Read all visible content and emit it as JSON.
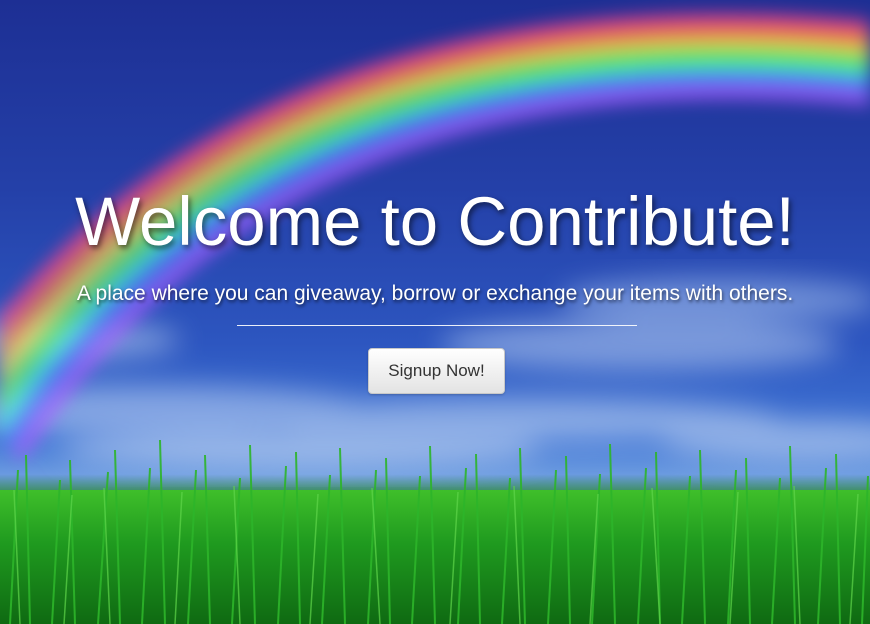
{
  "hero": {
    "title": "Welcome to Contribute!",
    "subtitle": "A place where you can giveaway, borrow or exchange your items with others.",
    "signup_label": "Signup Now!"
  },
  "colors": {
    "sky_top": "#1d2f94",
    "sky_horizon": "#6a9ae0",
    "grass": "#1f8a1f",
    "text": "#ffffff",
    "button_text": "#333333"
  }
}
